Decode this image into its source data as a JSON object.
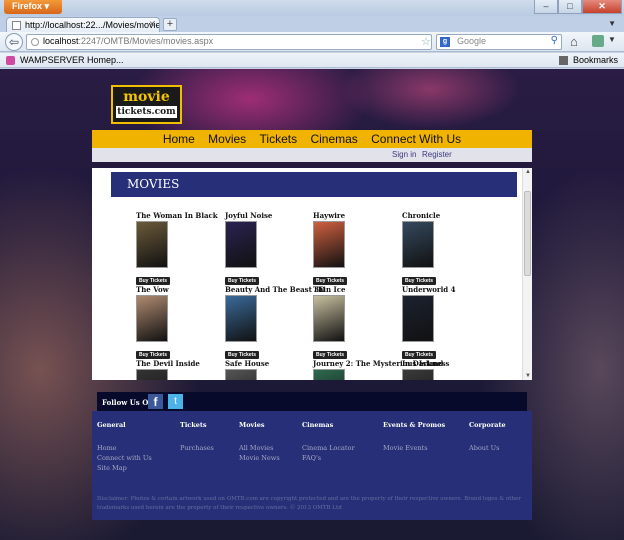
{
  "browser": {
    "app_button": "Firefox",
    "tab_title": "http://localhost:22.../Movies/movies.aspx",
    "new_tab": "+",
    "url_host": "localhost",
    "url_path": ":2247/OMTB/Movies/movies.aspx",
    "search_placeholder": "Google",
    "bookmark": "WAMPSERVER Homep...",
    "bookmarks_label": "Bookmarks"
  },
  "site": {
    "logo_line1": "movie",
    "logo_line2": "tickets.com",
    "menu": [
      "Home",
      "Movies",
      "Tickets",
      "Cinemas",
      "Connect With Us"
    ],
    "signin": "Sign in",
    "register": "Register",
    "page_title": "MOVIES",
    "buy_label": "Buy Tickets",
    "movies": [
      {
        "title": "The Woman In Black",
        "color": "#6b5a3a"
      },
      {
        "title": "Joyful Noise",
        "color": "#2a2350"
      },
      {
        "title": "Haywire",
        "color": "#d06040"
      },
      {
        "title": "Chronicle",
        "color": "#34495e"
      },
      {
        "title": "The Vow",
        "color": "#b08a70"
      },
      {
        "title": "Beauty And The Beast 3D",
        "color": "#3a6a9a"
      },
      {
        "title": "Thin Ice",
        "color": "#c8c0a0"
      },
      {
        "title": "Underworld 4",
        "color": "#1c2230"
      },
      {
        "title": "The Devil Inside",
        "color": "#333333"
      },
      {
        "title": "Safe House",
        "color": "#555555"
      },
      {
        "title": "Journey 2: The Mysterious Island",
        "color": "#2d6a4f"
      },
      {
        "title": "In Darkness",
        "color": "#3a3a3a"
      }
    ],
    "follow_label": "Follow Us On",
    "footer": {
      "general": {
        "head": "General",
        "links": [
          "Home",
          "Connect with Us",
          "Site Map"
        ]
      },
      "tickets": {
        "head": "Tickets",
        "links": [
          "Purchases"
        ]
      },
      "movies": {
        "head": "Movies",
        "links": [
          "All Movies",
          "Movie News"
        ]
      },
      "cinemas": {
        "head": "Cinemas",
        "links": [
          "Cinema Locator",
          "FAQ's"
        ]
      },
      "events": {
        "head": "Events & Promos",
        "links": [
          "Movie Events"
        ]
      },
      "corporate": {
        "head": "Corporate",
        "links": [
          "About Us"
        ]
      }
    },
    "disclaimer": "Disclaimer: Photos & certain artwork used on OMTB.com are copyright protected and are the property of their respective owners. Brand logos & other trademarks used herein are the property of their respective owners. © 2013 OMTB Ltd"
  }
}
